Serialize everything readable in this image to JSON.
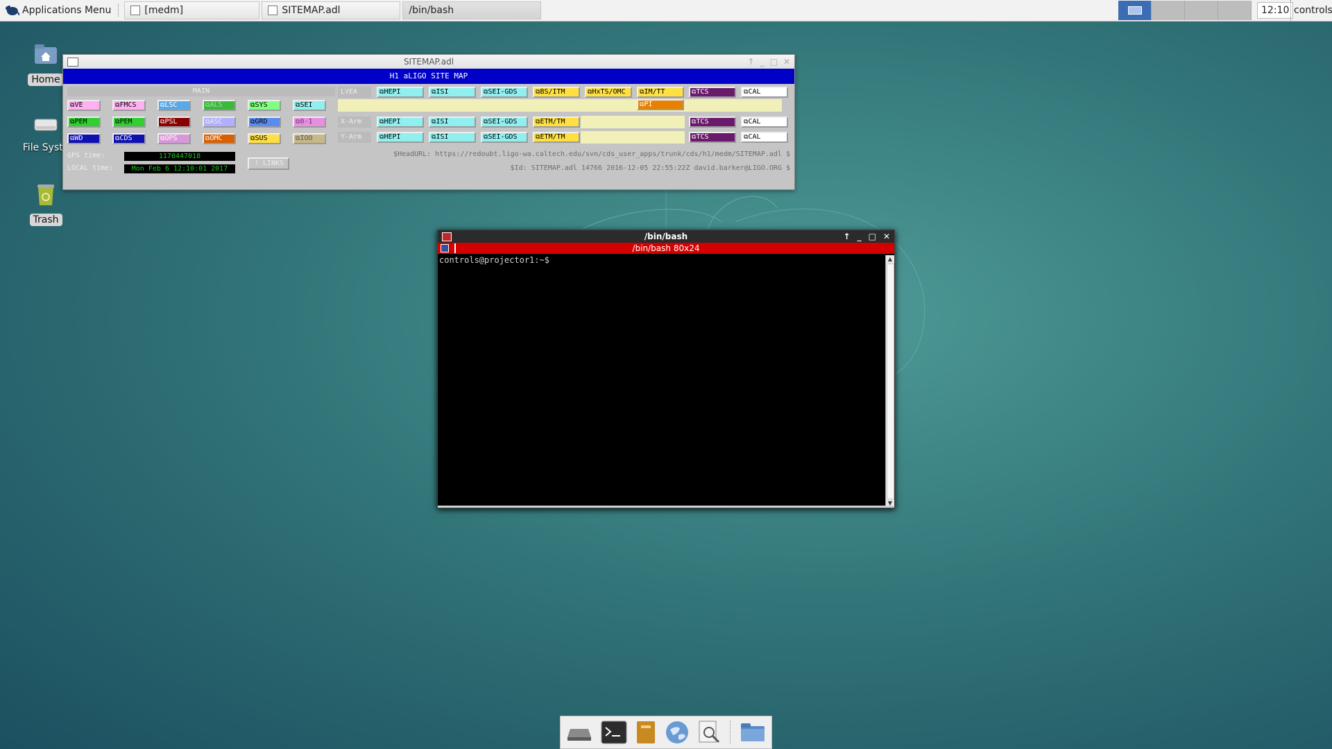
{
  "panel": {
    "app_menu": "Applications Menu",
    "tasks": [
      {
        "label": "[medm]"
      },
      {
        "label": "SITEMAP.adl"
      },
      {
        "label": "/bin/bash"
      }
    ],
    "clock": "12:10",
    "user": "controls"
  },
  "desktop": {
    "icons": [
      {
        "label": "Home"
      },
      {
        "label": "File Syste"
      },
      {
        "label": "Trash"
      }
    ]
  },
  "sitemap": {
    "window_title": "SITEMAP.adl",
    "banner": "H1 aLIGO SITE MAP",
    "main_label": "MAIN",
    "lvea_label": "LVEA",
    "xarm_label": "X-Arm",
    "yarm_label": "Y-Arm",
    "main_rows": [
      [
        "VE",
        "FMCS",
        "LSC",
        "ALS",
        "SYS",
        "SEI"
      ],
      [
        "PEM",
        "PEM",
        "PSL",
        "ASC",
        "GRD",
        "0-1"
      ],
      [
        "WD",
        "CDS",
        "OPS",
        "OMC",
        "SUS",
        "IOO"
      ]
    ],
    "lvea_row": [
      "HEPI",
      "ISI",
      "SEI-GDS",
      "BS/ITM",
      "HxTS/OMC",
      "IM/TT",
      "TCS",
      "CAL"
    ],
    "lvea_extra": "PI",
    "xarm_row": [
      "HEPI",
      "ISI",
      "SEI-GDS",
      "ETM/TM",
      "TCS",
      "CAL"
    ],
    "yarm_row": [
      "HEPI",
      "ISI",
      "SEI-GDS",
      "ETM/TM",
      "TCS",
      "CAL"
    ],
    "gps_label": "GPS time:",
    "gps_value": "1170447018",
    "local_label": "LOCAL time:",
    "local_value": "Mon Feb  6 12:10:01 2017",
    "links_label": "! LINKS",
    "head_url": "$HeadURL: https://redoubt.ligo-wa.caltech.edu/svn/cds_user_apps/trunk/cds/h1/medm/SITEMAP.adl $",
    "id_line": "$Id: SITEMAP.adl 14766 2016-12-05 22:55:22Z david.barker@LIGO.ORG $"
  },
  "terminal": {
    "title": "/bin/bash",
    "bar": "/bin/bash 80x24",
    "prompt": "controls@projector1:~$"
  },
  "dock": {
    "items": [
      "drive-icon",
      "terminal-icon",
      "files-icon",
      "browser-icon",
      "search-icon",
      "folder-icon"
    ]
  }
}
